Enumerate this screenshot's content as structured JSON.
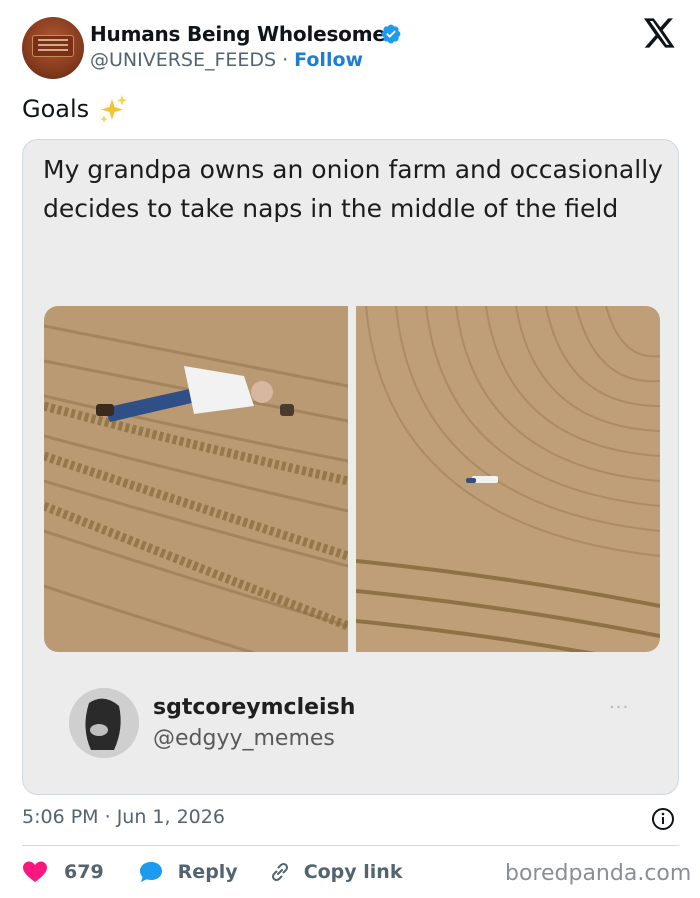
{
  "author": {
    "name": "Humans Being Wholesome",
    "handle": "@UNIVERSE_FEEDS",
    "separator": "·",
    "follow_label": "Follow",
    "verified": true,
    "avatar_icon": "red-sign-avatar"
  },
  "platform_icon": "x-logo-icon",
  "tweet": {
    "text": "Goals",
    "emoji": "sparkles-icon"
  },
  "quoted_post": {
    "text": "My grandpa owns an onion farm and occasionally decides to take naps in the middle of the field",
    "user_name": "sgtcoreymcleish",
    "user_handle": "@edgyy_memes",
    "more_label": "···",
    "images": [
      "man lying in onion field close-up",
      "aerial view of man in curved field rows"
    ]
  },
  "meta": {
    "time": "5:06 PM",
    "separator": "·",
    "date": "Jun 1, 2026"
  },
  "actions": {
    "likes": "679",
    "reply_label": "Reply",
    "copy_label": "Copy link"
  },
  "watermark": "boredpanda.com",
  "colors": {
    "like": "#f91880",
    "accent": "#1d9bf0",
    "muted": "#536471"
  }
}
